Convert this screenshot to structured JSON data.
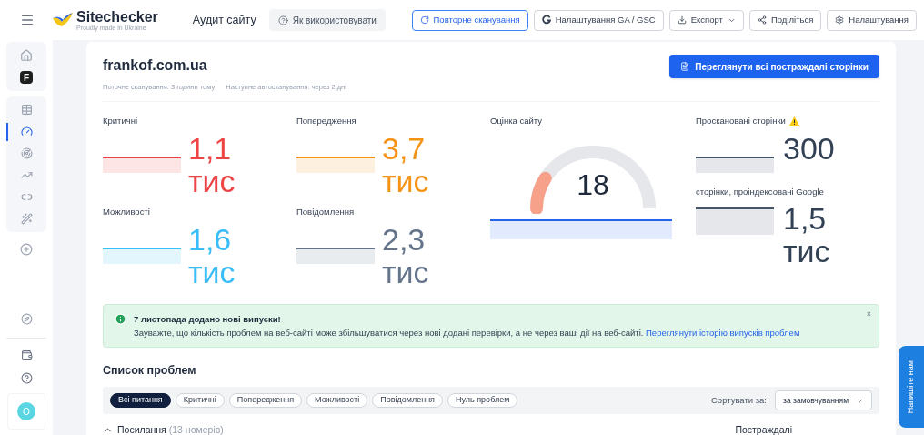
{
  "header": {
    "logo": "Sitechecker",
    "logo_tagline": "Proudly made in Ukraine",
    "page_title": "Аудит сайту",
    "help_button": "Як використовувати",
    "actions": [
      {
        "label": "Повторне сканування",
        "primary": true
      },
      {
        "label": "Налаштування GA / GSC",
        "primary": false
      },
      {
        "label": "Експорт",
        "primary": false
      },
      {
        "label": "Поділіться",
        "primary": false
      },
      {
        "label": "Налаштування",
        "primary": false
      }
    ]
  },
  "sidebar": {
    "project_badge": "F",
    "items": [
      {
        "selected": false
      },
      {
        "selected": true
      },
      {
        "selected": false
      },
      {
        "selected": false
      },
      {
        "selected": false
      },
      {
        "selected": false
      },
      {
        "selected": false
      }
    ],
    "avatar": "O"
  },
  "site": {
    "domain": "frankof.com.ua",
    "current_scan": "Поточне сканування: 3 години тому",
    "next_scan": "Наступне автосканування: через 2 дні",
    "view_button": "Переглянути всі постраждалі сторінки"
  },
  "metrics": [
    {
      "label": "Критичні",
      "value": "1,1",
      "unit": "тис",
      "color": "#ef4444"
    },
    {
      "label": "Попередження",
      "value": "3,7",
      "unit": "тис",
      "color": "#f59316"
    },
    {
      "label": "Можливості",
      "value": "1,6",
      "unit": "тис",
      "color": "#38bdf8"
    },
    {
      "label": "Повідомлення",
      "value": "2,3",
      "unit": "тис",
      "color": "#64748b"
    }
  ],
  "score": {
    "label": "Оцінка сайту",
    "value": "18"
  },
  "pages": [
    {
      "label": "Проскановані сторінки",
      "warning": true,
      "value": "300"
    },
    {
      "label": "сторінки, проіндексовані Google",
      "warning": false,
      "value": "1,5",
      "unit": "тис"
    }
  ],
  "notice": {
    "title": "7 листопада додано нові випуски!",
    "text": "Зауважте, що кількість проблем на веб-сайті може збільшуватися через нові додані перевірки, а не через ваші дії на веб-сайті.",
    "link": "Переглянути історію випусків проблем",
    "close": "×"
  },
  "issues": {
    "title": "Список проблем",
    "filters": [
      {
        "label": "Всі питання",
        "selected": true
      },
      {
        "label": "Критичні",
        "selected": false
      },
      {
        "label": "Попередження",
        "selected": false
      },
      {
        "label": "Можливості",
        "selected": false
      },
      {
        "label": "Повідомлення",
        "selected": false
      },
      {
        "label": "Нуль проблем",
        "selected": false
      }
    ],
    "sort_label": "Сортувати за:",
    "sort_value": "за замовчуванням",
    "group": "Посилання",
    "group_count": "(13 номерів)",
    "column": "Постраждалі"
  },
  "chat_button": "Напишіте нам"
}
